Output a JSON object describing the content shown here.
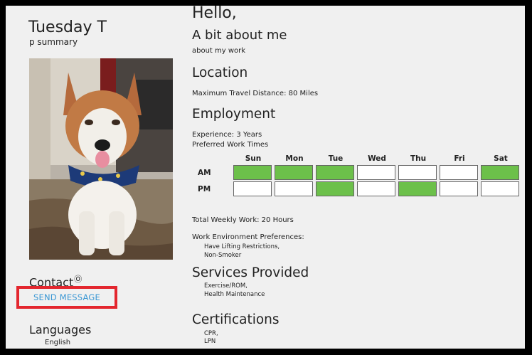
{
  "profile": {
    "name": "Tuesday T",
    "summary": "p summary",
    "contact_label": "Contact",
    "send_message_label": "SEND MESSAGE",
    "languages_label": "Languages",
    "languages": [
      "English"
    ]
  },
  "about": {
    "greeting": "Hello,",
    "heading": "A bit about me",
    "text": "about my work"
  },
  "location": {
    "heading": "Location",
    "travel_distance": "Maximum Travel Distance: 80 Miles"
  },
  "employment": {
    "heading": "Employment",
    "experience": "Experience: 3 Years",
    "preferred_times_label": "Preferred Work Times",
    "days": [
      "Sun",
      "Mon",
      "Tue",
      "Wed",
      "Thu",
      "Fri",
      "Sat"
    ],
    "rows": [
      {
        "label": "AM",
        "slots": [
          true,
          true,
          true,
          false,
          false,
          false,
          true
        ]
      },
      {
        "label": "PM",
        "slots": [
          false,
          false,
          true,
          false,
          true,
          false,
          false
        ]
      }
    ],
    "total_weekly": "Total Weekly Work: 20 Hours",
    "env_label": "Work Environment Preferences:",
    "env_items": [
      "Have Lifting Restrictions,",
      "Non-Smoker"
    ]
  },
  "services": {
    "heading": "Services Provided",
    "items": [
      "Exercise/ROM,",
      "Health Maintenance"
    ]
  },
  "certifications": {
    "heading": "Certifications",
    "items": [
      "CPR,",
      "LPN"
    ]
  },
  "colors": {
    "available": "#6cc04a",
    "link": "#3a97d4",
    "highlight_border": "#e3262e"
  }
}
